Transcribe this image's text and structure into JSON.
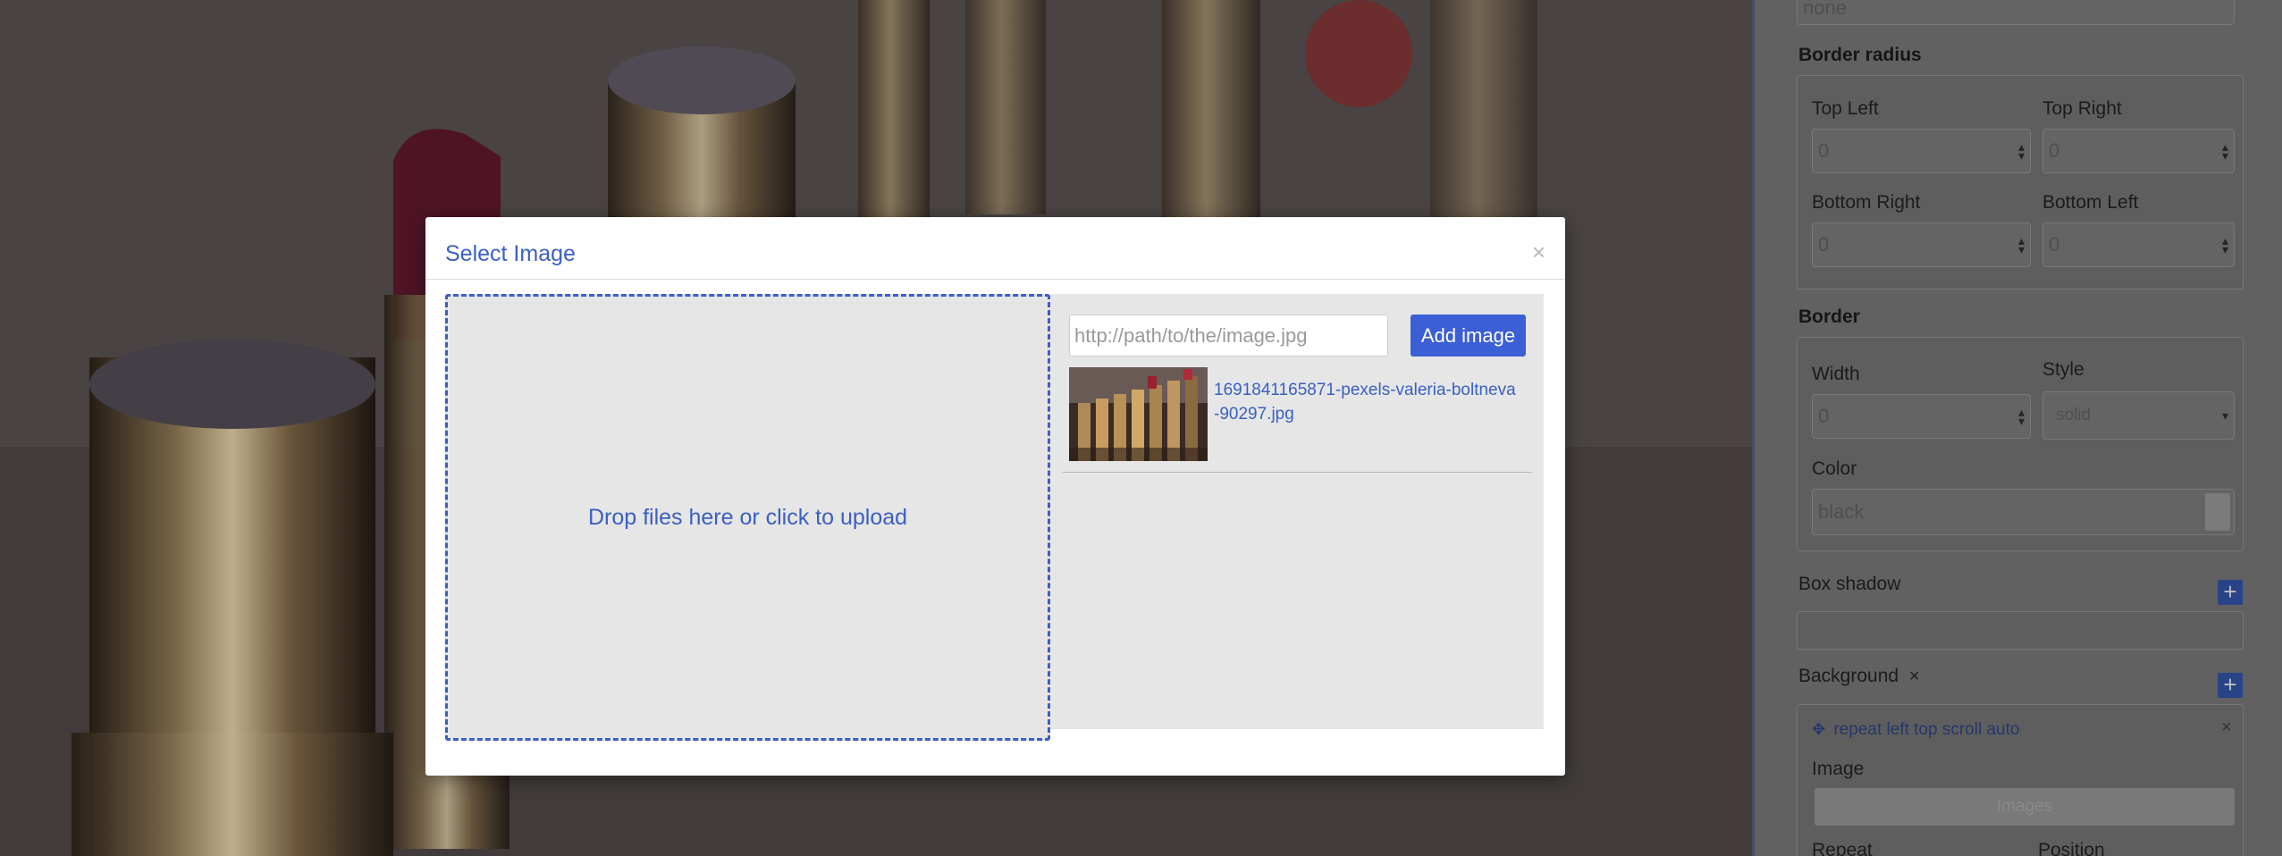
{
  "modal": {
    "title": "Select Image",
    "close_label": "×",
    "dropzone_text": "Drop files here or click to upload",
    "url_placeholder": "http://path/to/the/image.jpg",
    "add_image_label": "Add image",
    "assets": [
      {
        "filename": "1691841165871-pexels-valeria-boltneva-90297.jpg"
      }
    ]
  },
  "panel": {
    "top_input_value": "none",
    "border_radius": {
      "title": "Border radius",
      "top_left": {
        "label": "Top Left",
        "value": "0"
      },
      "top_right": {
        "label": "Top Right",
        "value": "0"
      },
      "bottom_right": {
        "label": "Bottom Right",
        "value": "0"
      },
      "bottom_left": {
        "label": "Bottom Left",
        "value": "0"
      }
    },
    "border": {
      "title": "Border",
      "width": {
        "label": "Width",
        "value": "0"
      },
      "style": {
        "label": "Style",
        "value": "solid"
      },
      "color": {
        "label": "Color",
        "value": "black"
      }
    },
    "box_shadow": {
      "label": "Box shadow",
      "add_label": "+"
    },
    "background": {
      "label": "Background",
      "remove_label": "×",
      "add_label": "+",
      "layer_label": "repeat left top scroll auto",
      "layer_remove": "×",
      "image_label": "Image",
      "image_button": "Images",
      "repeat_label": "Repeat",
      "position_label": "Position"
    }
  },
  "colors": {
    "accent": "#3b5fc4",
    "button": "#3b5fd4",
    "panel_bg": "#6f6f6f"
  }
}
